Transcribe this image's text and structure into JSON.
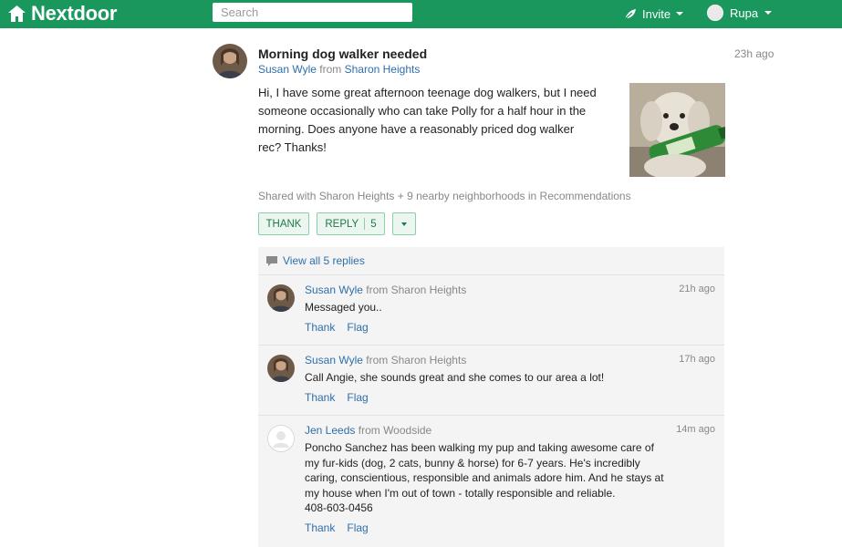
{
  "header": {
    "brand": "Nextdoor",
    "search_placeholder": "Search",
    "invite_label": "Invite",
    "user_name": "Rupa"
  },
  "post": {
    "title": "Morning dog walker needed",
    "author": "Susan Wyle",
    "from_word": "from",
    "neighborhood": "Sharon Heights",
    "time": "23h ago",
    "body": "Hi, I have some great afternoon teenage dog walkers, but I need someone occasionally who can take Polly for a half hour in the morning. Does anyone have a reasonably priced dog walker rec? Thanks!",
    "shared_text": "Shared with Sharon Heights + 9 nearby neighborhoods in Recommendations",
    "thank_label": "THANK",
    "reply_label": "REPLY",
    "reply_count": "5"
  },
  "replies": {
    "view_all_label": "View all 5 replies",
    "items": [
      {
        "author": "Susan Wyle",
        "from_text": "from Sharon Heights",
        "time": "21h ago",
        "text": "Messaged you..",
        "thank_label": "Thank",
        "flag_label": "Flag"
      },
      {
        "author": "Susan Wyle",
        "from_text": "from Sharon Heights",
        "time": "17h ago",
        "text": "Call Angie, she sounds great and she comes to our area a lot!",
        "thank_label": "Thank",
        "flag_label": "Flag"
      },
      {
        "author": "Jen Leeds",
        "from_text": "from Woodside",
        "time": "14m ago",
        "text": "Poncho Sanchez has been walking my pup and taking awesome care of my fur-kids (dog, 2 cats, bunny & horse) for 6-7 years. He's incredibly caring, conscientious, responsible and animals adore him. And he stays at my house when I'm out of town - totally responsible and reliable.",
        "phone": "408-603-0456",
        "thank_label": "Thank",
        "flag_label": "Flag"
      }
    ]
  },
  "colors": {
    "brand_green": "#19975d",
    "link_blue": "#2f6faa",
    "button_green": "#1d7a47"
  }
}
